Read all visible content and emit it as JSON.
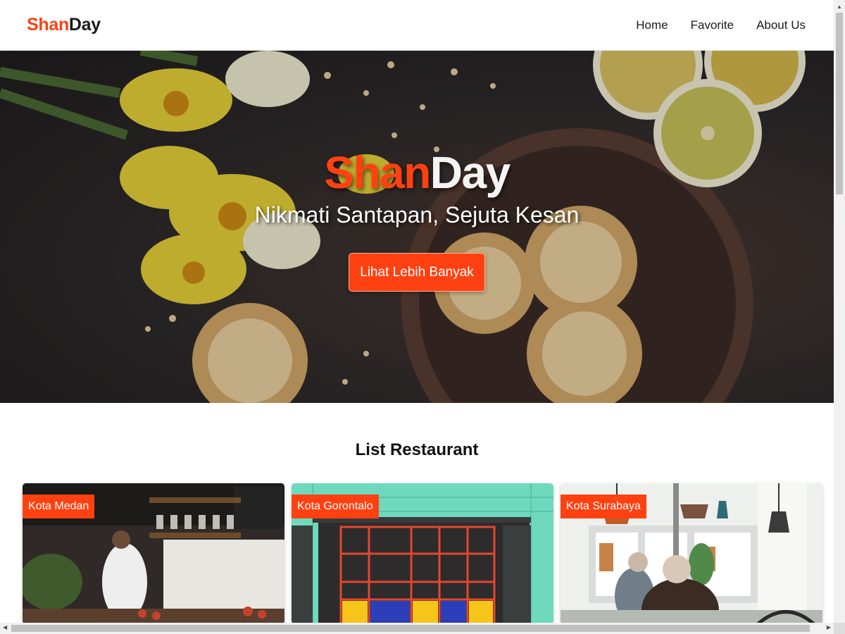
{
  "header": {
    "brand": {
      "accent": "Shan",
      "rest": "Day"
    },
    "nav": [
      {
        "label": "Home"
      },
      {
        "label": "Favorite"
      },
      {
        "label": "About Us"
      }
    ]
  },
  "hero": {
    "title": {
      "accent": "Shan",
      "rest": "Day"
    },
    "subtitle": "Nikmati Santapan, Sejuta Kesan",
    "button_label": "Lihat Lebih Banyak"
  },
  "list": {
    "title": "List Restaurant",
    "cards": [
      {
        "city": "Kota Medan"
      },
      {
        "city": "Kota Gorontalo"
      },
      {
        "city": "Kota Surabaya"
      }
    ]
  },
  "colors": {
    "accent": "#ff4111",
    "text": "#1a1a1a"
  },
  "icons": {
    "scroll_up": "triangle-up-icon",
    "scroll_left": "triangle-left-icon",
    "scroll_right": "triangle-right-icon"
  }
}
